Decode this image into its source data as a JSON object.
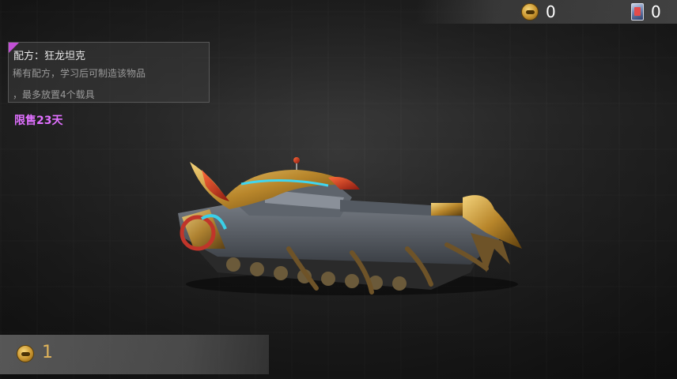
{
  "currencies": [
    {
      "icon": "gold-coin-icon",
      "value": "0"
    },
    {
      "icon": "card-icon",
      "value": "0"
    }
  ],
  "recipe": {
    "title": "配方：狂龙坦克",
    "line1": "稀有配方，学习后可制造该物品",
    "line2": "，最多放置4个载具",
    "limited": "限售23天"
  },
  "price": {
    "icon": "gold-coin-icon",
    "value": "1"
  },
  "colors": {
    "accent_purple": "#c24fd6",
    "limited_text": "#e070ff",
    "price_text": "#e0b45a"
  }
}
